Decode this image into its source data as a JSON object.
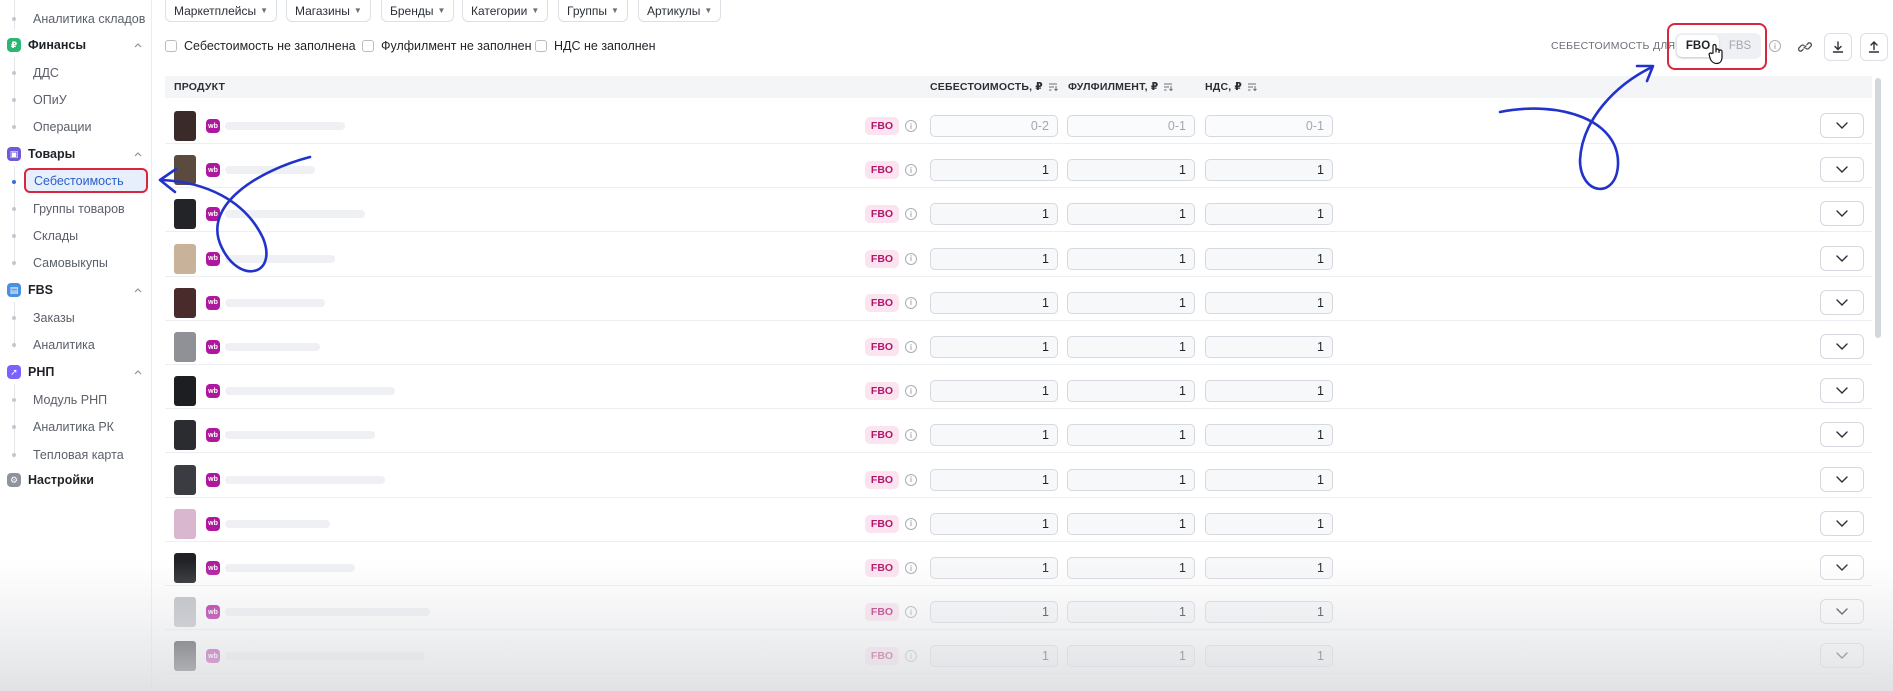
{
  "sidebar": {
    "items_top": [
      {
        "label": "Аналитика складов"
      }
    ],
    "finance": {
      "label": "Финансы",
      "items": [
        {
          "label": "ДДС"
        },
        {
          "label": "ОПиУ"
        },
        {
          "label": "Операции"
        }
      ]
    },
    "goods": {
      "label": "Товары",
      "items": [
        {
          "label": "Себестоимость"
        },
        {
          "label": "Группы товаров"
        },
        {
          "label": "Склады"
        },
        {
          "label": "Самовыкупы"
        }
      ]
    },
    "fbs": {
      "label": "FBS",
      "items": [
        {
          "label": "Заказы"
        },
        {
          "label": "Аналитика"
        }
      ]
    },
    "rnp": {
      "label": "РНП",
      "items": [
        {
          "label": "Модуль РНП"
        },
        {
          "label": "Аналитика РК"
        },
        {
          "label": "Тепловая карта"
        }
      ]
    },
    "settings": {
      "label": "Настройки"
    },
    "active_item": "Себестоимость",
    "colors": {
      "finance": "#2bb673",
      "goods": "#6f5bd8",
      "fbs": "#4a90e2",
      "rnp": "#7b61ff",
      "settings": "#8e939c"
    }
  },
  "filters": [
    "Маркетплейсы",
    "Магазины",
    "Бренды",
    "Категории",
    "Группы",
    "Артикулы"
  ],
  "checkboxes": [
    {
      "label": "Себестоимость не заполнена",
      "checked": false
    },
    {
      "label": "Фулфилмент не заполнен",
      "checked": false
    },
    {
      "label": "НДС не заполнен",
      "checked": false
    }
  ],
  "toolbar": {
    "cost_for_label": "СЕБЕСТОИМОСТЬ ДЛЯ:",
    "fbo": "FBO",
    "fbs": "FBS",
    "selected": "FBO"
  },
  "table": {
    "headers": {
      "product": "ПРОДУКТ",
      "cost": "СЕБЕСТОИМОСТЬ, ₽",
      "fulfillment": "ФУЛФИЛМЕНТ, ₽",
      "vat": "НДС, ₽"
    },
    "marketplace_badge": "wb",
    "rows": [
      {
        "badge": "FBO",
        "cost": "0-2",
        "fulfillment": "0-1",
        "vat": "0-1",
        "empty": true,
        "thumb": "#3a2a2a"
      },
      {
        "badge": "FBO",
        "cost": "1",
        "fulfillment": "1",
        "vat": "1",
        "thumb": "#5b4a3e"
      },
      {
        "badge": "FBO",
        "cost": "1",
        "fulfillment": "1",
        "vat": "1",
        "thumb": "#222428"
      },
      {
        "badge": "FBO",
        "cost": "1",
        "fulfillment": "1",
        "vat": "1",
        "thumb": "#c8b29a"
      },
      {
        "badge": "FBO",
        "cost": "1",
        "fulfillment": "1",
        "vat": "1",
        "thumb": "#4a2b2b"
      },
      {
        "badge": "FBO",
        "cost": "1",
        "fulfillment": "1",
        "vat": "1",
        "thumb": "#8f9197"
      },
      {
        "badge": "FBO",
        "cost": "1",
        "fulfillment": "1",
        "vat": "1",
        "thumb": "#1d1e22"
      },
      {
        "badge": "FBO",
        "cost": "1",
        "fulfillment": "1",
        "vat": "1",
        "thumb": "#2b2c30"
      },
      {
        "badge": "FBO",
        "cost": "1",
        "fulfillment": "1",
        "vat": "1",
        "thumb": "#3b3c42"
      },
      {
        "badge": "FBO",
        "cost": "1",
        "fulfillment": "1",
        "vat": "1",
        "thumb": "#d9b7cf"
      },
      {
        "badge": "FBO",
        "cost": "1",
        "fulfillment": "1",
        "vat": "1",
        "thumb": "#202124"
      },
      {
        "badge": "FBO",
        "cost": "1",
        "fulfillment": "1",
        "vat": "1",
        "thumb": "#b9bcc2"
      },
      {
        "badge": "FBO",
        "cost": "1",
        "fulfillment": "1",
        "vat": "1",
        "thumb": "#26272b"
      }
    ]
  }
}
